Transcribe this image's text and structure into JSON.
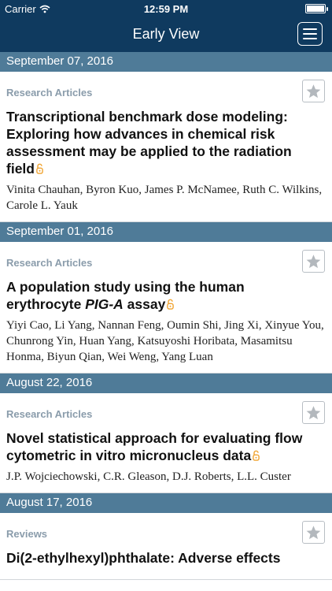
{
  "status_bar": {
    "carrier": "Carrier",
    "time": "12:59 PM"
  },
  "nav": {
    "title": "Early View"
  },
  "sections": [
    {
      "date": "September 07, 2016",
      "articles": [
        {
          "category": "Research Articles",
          "title": "Transcriptional benchmark dose modeling: Exploring how advances in chemical risk assessment may be applied to the radiation field",
          "authors": "Vinita Chauhan, Byron Kuo, James P. McNamee, Ruth C. Wilkins, Carole L. Yauk"
        }
      ]
    },
    {
      "date": "September 01, 2016",
      "articles": [
        {
          "category": "Research Articles",
          "title_before": "A population study using the human erythrocyte ",
          "title_italic": "PIG-A",
          "title_after": " assay",
          "authors": "Yiyi Cao, Li Yang, Nannan Feng, Oumin Shi, Jing Xi, Xinyue You, Chunrong Yin, Huan Yang, Katsuyoshi Horibata, Masamitsu Honma, Biyun Qian, Wei Weng, Yang Luan"
        }
      ]
    },
    {
      "date": "August 22, 2016",
      "articles": [
        {
          "category": "Research Articles",
          "title": "Novel statistical approach for evaluating flow cytometric in vitro micronucleus data",
          "authors": "J.P. Wojciechowski, C.R. Gleason, D.J. Roberts, L.L. Custer"
        }
      ]
    },
    {
      "date": "August 17, 2016",
      "articles": [
        {
          "category": "Reviews",
          "title": "Di(2-ethylhexyl)phthalate: Adverse effects",
          "authors": ""
        }
      ]
    }
  ],
  "icons": {
    "wifi": "wifi-icon",
    "battery": "battery-icon",
    "menu": "menu-icon",
    "star": "star-icon",
    "open_access": "open-access-icon"
  },
  "colors": {
    "nav_background": "#0f3a5f",
    "date_header": "#4f7b98",
    "category_text": "#8a9cab",
    "open_access": "#f0a330"
  }
}
